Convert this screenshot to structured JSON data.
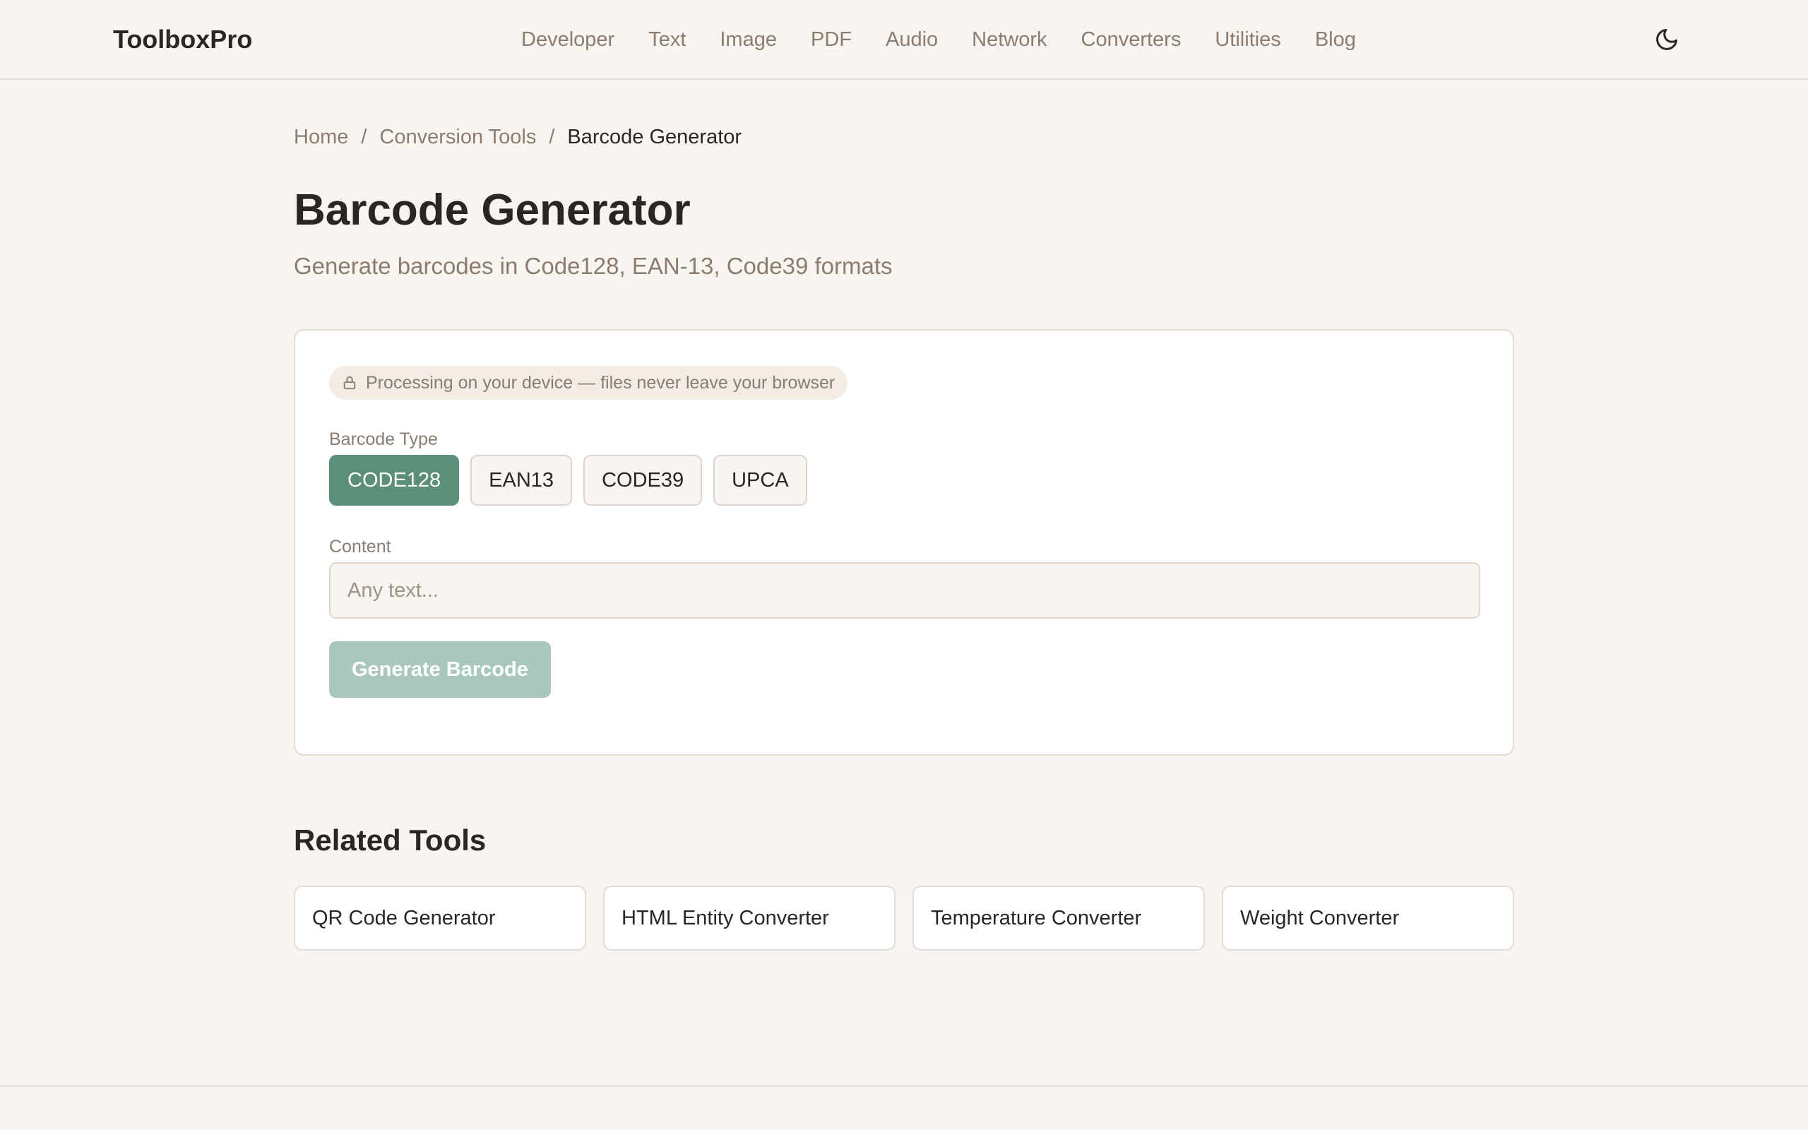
{
  "header": {
    "brand": "ToolboxPro",
    "nav": [
      "Developer",
      "Text",
      "Image",
      "PDF",
      "Audio",
      "Network",
      "Converters",
      "Utilities",
      "Blog"
    ],
    "theme_icon": "moon-icon"
  },
  "breadcrumb": {
    "home": "Home",
    "separator": "/",
    "section": "Conversion Tools",
    "current": "Barcode Generator"
  },
  "page": {
    "title": "Barcode Generator",
    "subtitle": "Generate barcodes in Code128, EAN-13, Code39 formats"
  },
  "tool": {
    "privacy_note": "Processing on your device — files never leave your browser",
    "privacy_icon": "lock-icon",
    "barcode_type_label": "Barcode Type",
    "barcode_types": [
      "CODE128",
      "EAN13",
      "CODE39",
      "UPCA"
    ],
    "selected_type": "CODE128",
    "content_label": "Content",
    "content_value": "",
    "content_placeholder": "Any text...",
    "generate_label": "Generate Barcode"
  },
  "related": {
    "title": "Related Tools",
    "items": [
      "QR Code Generator",
      "HTML Entity Converter",
      "Temperature Converter",
      "Weight Converter"
    ]
  },
  "colors": {
    "accent": "#5c8f7a",
    "accent_disabled": "#a9c8bb",
    "background": "#f8f4ef",
    "muted_text": "#8a7c71"
  }
}
